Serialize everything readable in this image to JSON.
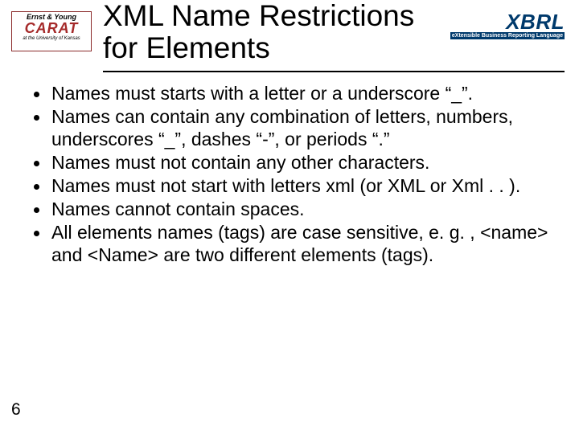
{
  "header": {
    "title_line1": "XML Name Restrictions",
    "title_line2": "for Elements",
    "logo_left": {
      "line1": "Ernst & Young",
      "line2": "CARAT",
      "line3": "at the University of Kansas"
    },
    "logo_right": {
      "name": "XBRL",
      "tagline": "eXtensible Business Reporting Language"
    }
  },
  "bullets": [
    "Names must starts with a letter or a underscore “_”.",
    "Names can contain any combination of letters, numbers, underscores “_”, dashes “-”, or periods “.”",
    "Names must not contain any other characters.",
    "Names must not start with letters xml (or XML or Xml . . ).",
    "Names cannot contain spaces.",
    "All elements names (tags) are case sensitive, e. g. , <name> and <Name> are two different elements (tags)."
  ],
  "page_number": "6"
}
